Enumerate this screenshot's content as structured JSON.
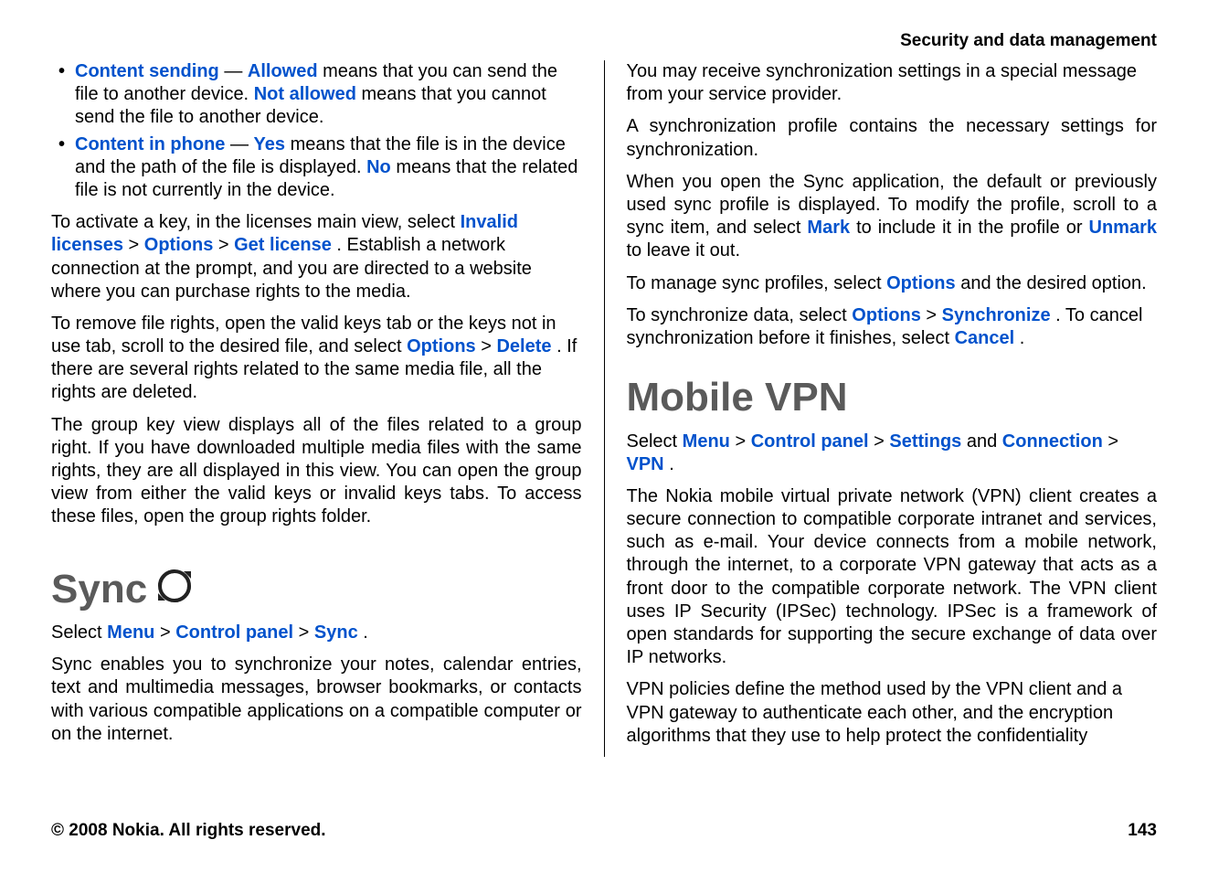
{
  "header": {
    "section": "Security and data management"
  },
  "left": {
    "bullets": {
      "cs_label": "Content sending",
      "cs_allowed": "Allowed",
      "cs_text1": " means that you can send the file to another device. ",
      "cs_notallowed": "Not allowed",
      "cs_text2": " means that you cannot send the file to another device.",
      "cp_label": "Content in phone",
      "cp_yes": "Yes",
      "cp_text1": " means that the file is in the device and the path of the file is displayed. ",
      "cp_no": "No",
      "cp_text2": " means that the related file is not currently in the device."
    },
    "activate": {
      "pre": "To activate a key, in the licenses main view, select ",
      "invalid_licenses": "Invalid licenses",
      "sep1": " > ",
      "options": "Options",
      "sep2": " > ",
      "get_license": "Get license",
      "post": ". Establish a network connection at the prompt, and you are directed to a website where you can purchase rights to the media."
    },
    "remove": {
      "pre": "To remove file rights, open the valid keys tab or the keys not in use tab, scroll to the desired file, and select ",
      "options": "Options",
      "sep": " > ",
      "delete": "Delete",
      "post": ". If there are several rights related to the same media file, all the rights are deleted."
    },
    "group": "The group key view displays all of the files related to a group right. If you have downloaded multiple media files with the same rights, they are all displayed in this view. You can open the group view from either the valid keys or invalid keys tabs. To access these files, open the group rights folder.",
    "sync": {
      "title": "Sync",
      "select_pre": "Select ",
      "menu": "Menu",
      "sep1": " > ",
      "control_panel": "Control panel",
      "sep2": " > ",
      "sync_label": "Sync",
      "post": ".",
      "desc": "Sync enables you to synchronize your notes, calendar entries, text and multimedia messages, browser bookmarks, or contacts with various compatible applications on a compatible computer or on the internet."
    }
  },
  "right": {
    "receive": "You may receive synchronization settings in a special message from your service provider.",
    "profile": "A synchronization profile contains the necessary settings for synchronization.",
    "open": {
      "pre": "When you open the Sync application, the default or previously used sync profile is displayed. To modify the profile, scroll to a sync item, and select ",
      "mark": "Mark",
      "mid": " to include it in the profile or ",
      "unmark": "Unmark",
      "post": " to leave it out."
    },
    "manage": {
      "pre": "To manage sync profiles, select ",
      "options": "Options",
      "post": " and the desired option."
    },
    "synchronize": {
      "pre": "To synchronize data, select ",
      "options": "Options",
      "sep": " > ",
      "synchronize": "Synchronize",
      "mid": ". To cancel synchronization before it finishes, select ",
      "cancel": "Cancel",
      "post": "."
    },
    "vpn": {
      "title": "Mobile VPN",
      "select_pre": "Select ",
      "menu": "Menu",
      "sep1": " > ",
      "control_panel": "Control panel",
      "sep2": " > ",
      "settings": "Settings",
      "and": " and ",
      "connection": "Connection",
      "sep3": " > ",
      "vpn_label": "VPN",
      "post": ".",
      "desc": "The Nokia mobile virtual private network (VPN) client creates a secure connection to compatible corporate intranet and services, such as e-mail. Your device connects from a mobile network, through the internet, to a corporate VPN gateway that acts as a front door to the compatible corporate network. The VPN client uses IP Security (IPSec) technology. IPSec is a framework of open standards for supporting the secure exchange of data over IP networks.",
      "policies": "VPN policies define the method used by the VPN client and a VPN gateway to authenticate each other, and the encryption algorithms that they use to help protect the confidentiality"
    }
  },
  "footer": {
    "copyright": "© 2008 Nokia. All rights reserved.",
    "page": "143"
  }
}
